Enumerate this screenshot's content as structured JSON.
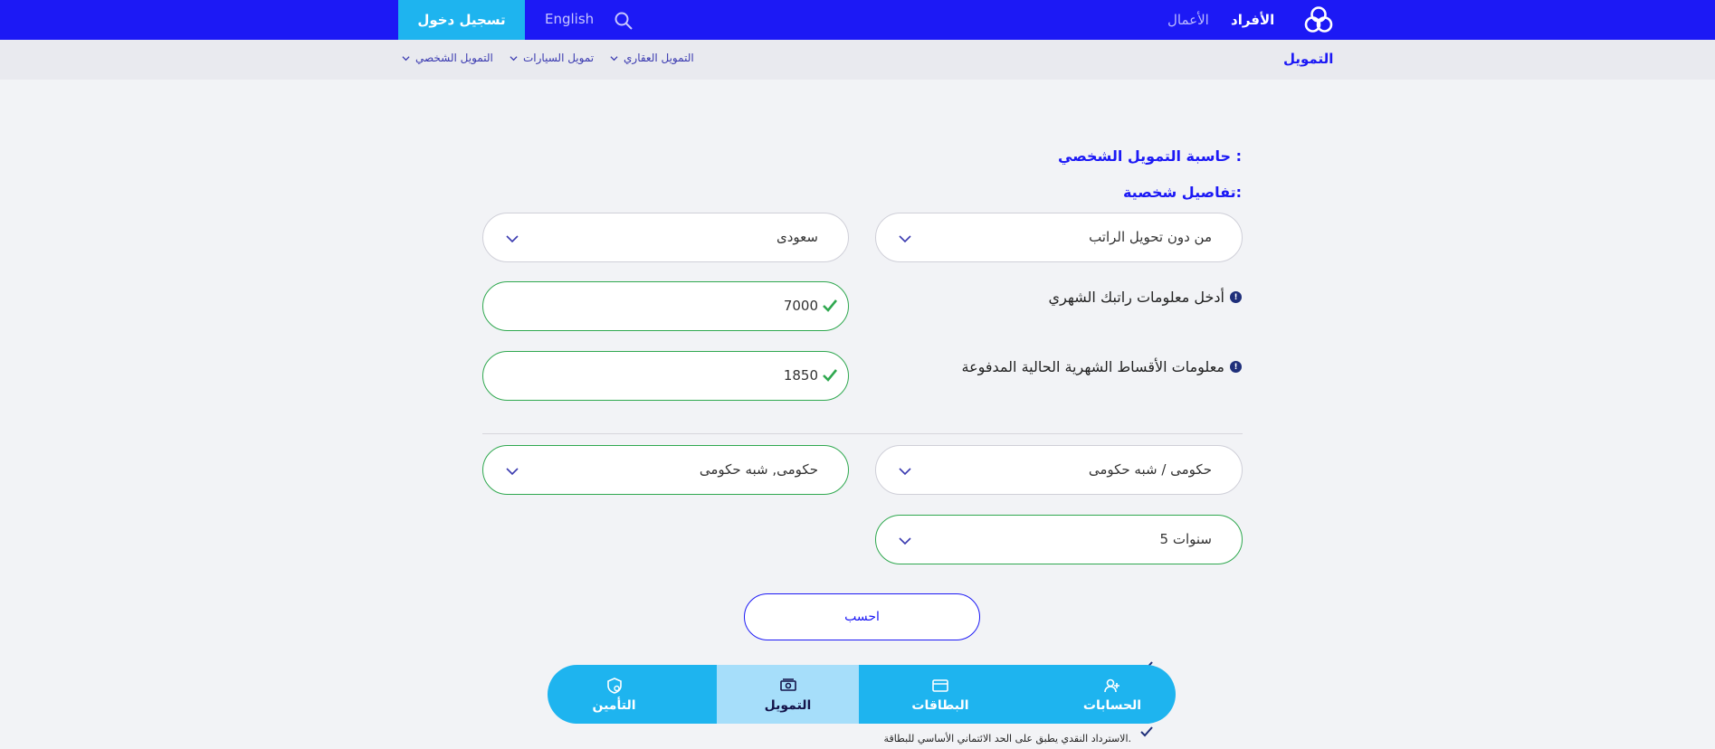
{
  "header": {
    "segments": {
      "individuals": "الأفراد",
      "business": "الأعمال"
    },
    "language_label": "English",
    "login_label": "تسجيل دخول",
    "icons": {
      "logo": "bank-logo-icon",
      "search": "search-icon"
    },
    "colors": {
      "brand": "#1c19f5",
      "accent": "#1eb4ef"
    }
  },
  "subnav": {
    "title": "التمويل",
    "items": [
      {
        "label": "التمويل العقاري"
      },
      {
        "label": "تمويل السيارات"
      },
      {
        "label": "التمويل الشخصي"
      }
    ]
  },
  "calculator": {
    "title": "حاسبة التمويل الشخصي :",
    "personal_heading": "تفاصيل شخصية:",
    "salary_transfer": {
      "value": "من دون تحويل الراتب"
    },
    "nationality": {
      "value": "سعودى"
    },
    "salary_label": "أدخل معلومات راتبك الشهري",
    "salary_value": "7000",
    "installments_label": "معلومات الأقساط الشهرية الحالية المدفوعة",
    "installments_value": "1850",
    "sector": {
      "value": "حكومى / شبه حكومى"
    },
    "employer": {
      "value": "حكومى, شبه حكومى"
    },
    "duration": {
      "value": "5 سنوات"
    },
    "calculate_label": "احسب",
    "status_colors": {
      "valid": "#2fa84f"
    }
  },
  "notes": {
    "last_note": "الاسترداد النقدي يطبق على الحد الائتماني الأساسي للبطاقة."
  },
  "tabbar": {
    "tabs": [
      {
        "label": "الحسابات",
        "icon": "accounts-icon"
      },
      {
        "label": "البطاقات",
        "icon": "cards-icon"
      },
      {
        "label": "التمويل",
        "icon": "finance-icon",
        "active": true
      },
      {
        "label": "التأمين",
        "icon": "insurance-icon"
      }
    ]
  }
}
